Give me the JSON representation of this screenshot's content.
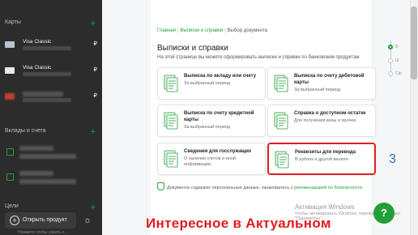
{
  "sidebar": {
    "cards_title": "Карты",
    "cards": [
      {
        "name": "Visa Classic",
        "currency": "₽",
        "thumb": "#b8c4d6"
      },
      {
        "name": "Visa Classic",
        "currency": "₽",
        "thumb": "#e8e8ee"
      },
      {
        "name": "",
        "currency": "₽",
        "thumb": "#c0402e"
      }
    ],
    "deposits_title": "Вклады и счета",
    "goals_title": "Цели",
    "open_product": "Открыть продукт",
    "bottom_hint": "Нажмите чтобы узнать о..."
  },
  "breadcrumb": {
    "home": "Главная",
    "statements": "Выписки и справки",
    "current": "Выбор документа"
  },
  "page": {
    "title": "Выписки и справки",
    "subtitle": "На этой странице вы можете сформировать выписки и справки по банковским продуктам"
  },
  "tiles": [
    {
      "title": "Выписка по вкладу или счету",
      "desc": "За выбранный период"
    },
    {
      "title": "Выписка по счету дебетовой карты",
      "desc": "За выбранный период"
    },
    {
      "title": "Выписка по счету кредитной карты",
      "desc": "За выбранный период"
    },
    {
      "title": "Справка о доступном остатке",
      "desc": "Для получения визы и прочее"
    },
    {
      "title": "Сведения для госслужащих",
      "desc": "О наличии счетов и иной информации"
    },
    {
      "title": "Реквизиты для перевода",
      "desc": "В рублях и другой валюте"
    }
  ],
  "notice": {
    "text": "Документы содержат персональные данные, ознакомьтесь с ",
    "link": "рекомендацией по безопасности"
  },
  "steps": [
    "В",
    "Ш",
    "Сф"
  ],
  "side_number": "3",
  "watermark": {
    "line1": "Активация Windows",
    "line2": "Чтобы активировать Windows, перейдите в раздел \"Параметры\"."
  },
  "overlay_text": "Интересное в Актуальном",
  "colors": {
    "accent": "#21a038",
    "highlight": "#e02020",
    "sidebar_bg": "#2c2c2c",
    "overlay": "#e21c1c"
  }
}
